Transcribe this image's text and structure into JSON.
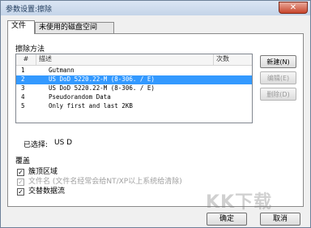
{
  "window": {
    "title": "参数设置:擦除",
    "close_label": "✕"
  },
  "tabs": [
    {
      "label": "文件"
    },
    {
      "label": "未使用的磁盘空间"
    }
  ],
  "methods": {
    "section_label": "擦除方法",
    "columns": {
      "num": "#",
      "desc": "描述",
      "passes": "次数"
    },
    "rows": [
      {
        "num": "1",
        "desc": "Gutmann",
        "passes": ""
      },
      {
        "num": "2",
        "desc": "US DoD 5220.22-M (8-306. / E)",
        "passes": ""
      },
      {
        "num": "3",
        "desc": "US DoD 5220.22-M (8-306. / E)",
        "passes": ""
      },
      {
        "num": "4",
        "desc": "Pseudorandom Data",
        "passes": ""
      },
      {
        "num": "5",
        "desc": "Only first and last 2KB",
        "passes": ""
      }
    ],
    "selected_index": 2
  },
  "buttons": {
    "new": "新建(N)",
    "edit": "编辑(E)",
    "delete": "删除(D)",
    "ok": "确定",
    "cancel": "取消"
  },
  "selection": {
    "label": "已选择:",
    "value": "US D"
  },
  "overwrite": {
    "section_label": "覆盖",
    "options": [
      {
        "label": "簇顶区域",
        "checked": true,
        "enabled": true
      },
      {
        "label": "文件名 (文件名经常会给NT/XP以上系统给清除)",
        "checked": true,
        "enabled": false
      },
      {
        "label": "交替数据流",
        "checked": true,
        "enabled": true
      }
    ]
  },
  "watermark": {
    "text": "KK下载"
  }
}
